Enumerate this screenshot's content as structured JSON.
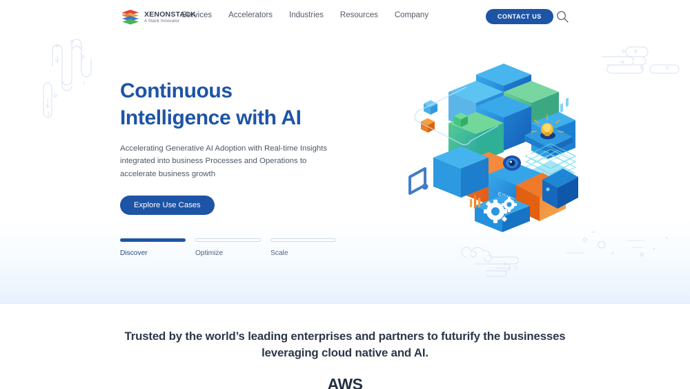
{
  "header": {
    "logo": {
      "name": "XENONSTACK",
      "tagline": "A Stack Innovator",
      "icon": "stacked-layers-logo",
      "colors": [
        "#e0463c",
        "#f0a33a",
        "#2f7fd0",
        "#4bb05a",
        "#8cc63f"
      ]
    },
    "nav_items": [
      {
        "label": "Services"
      },
      {
        "label": "Accelerators"
      },
      {
        "label": "Industries"
      },
      {
        "label": "Resources"
      },
      {
        "label": "Company"
      }
    ],
    "contact_label": "CONTACT US",
    "search_icon": "search-icon"
  },
  "hero": {
    "title_line1": "Continuous",
    "title_line2": "Intelligence with AI",
    "subtitle": "Accelerating Generative AI Adoption with Real-time Insights integrated into business Processes and Operations to accelerate business growth",
    "cta_label": "Explore Use Cases",
    "illustration": "isometric-ai-cubes-illustration",
    "illustration_label": "COMPUTER VISION",
    "tabs": [
      {
        "label": "Discover",
        "active": true
      },
      {
        "label": "Optimize",
        "active": false
      },
      {
        "label": "Scale",
        "active": false
      }
    ]
  },
  "trusted": {
    "heading": "Trusted by the world’s leading enterprises and partners to futurify the businesses leveraging cloud native and AI.",
    "partners": [
      {
        "name": "AWS"
      }
    ]
  },
  "colors": {
    "brand_blue": "#1d54a6",
    "text_dark": "#2d3748",
    "text_muted": "#4e5766",
    "band_blue": "#e4eefc"
  }
}
